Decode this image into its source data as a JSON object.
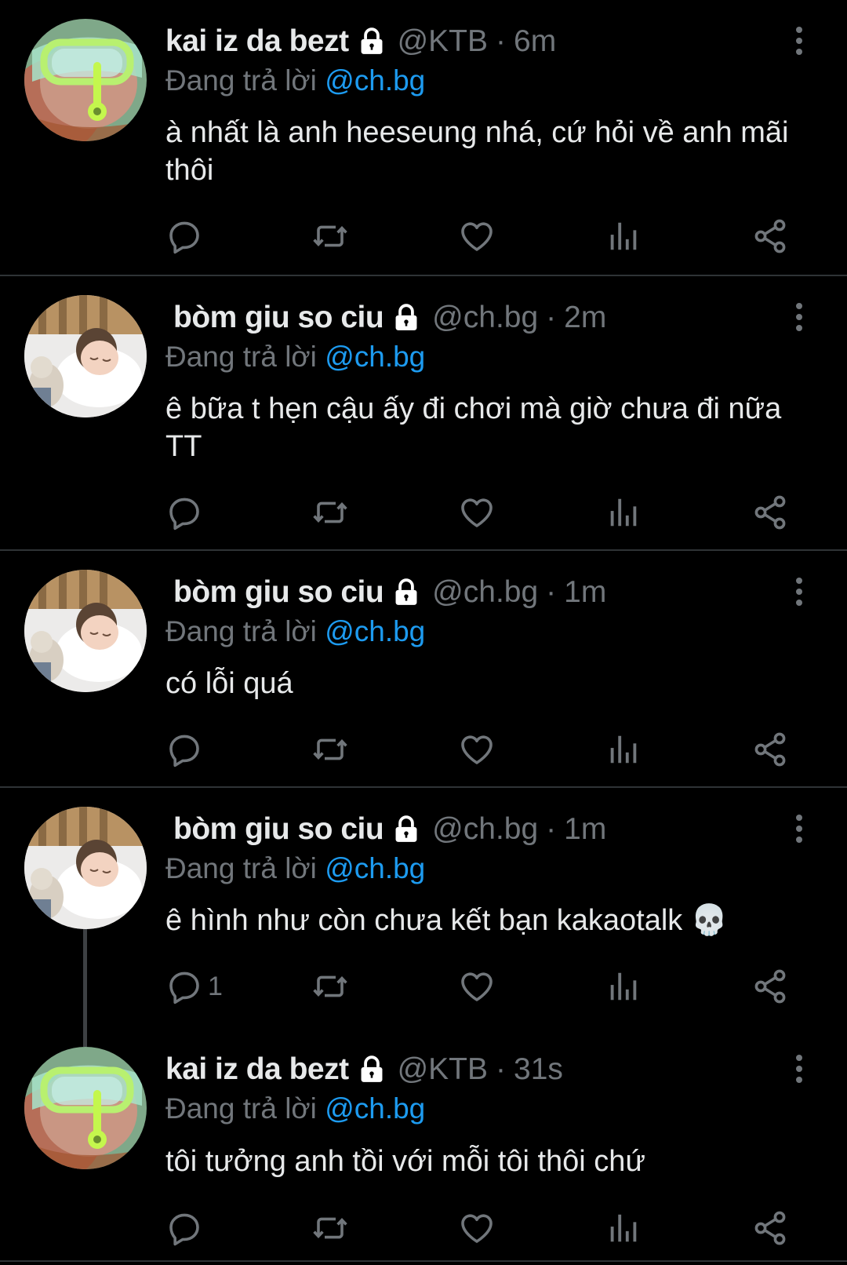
{
  "colors": {
    "background": "#000000",
    "text": "#e7e9ea",
    "secondary": "#71767b",
    "accent": "#1d9bf0",
    "divider": "#2f3336"
  },
  "tweets": [
    {
      "name": "kai iz da bezt",
      "handle": "@KTB",
      "dot": "·",
      "time": "6m",
      "reply_prefix": "Đang trả lời",
      "reply_mention": "@ch.bg",
      "text": "à nhất là anh heeseung nhá, cứ hỏi về anh mãi thôi",
      "reply_count": "",
      "avatar": "snorkel-avatar"
    },
    {
      "name": "bòm giu so ciu",
      "handle": "@ch.bg",
      "dot": "·",
      "time": "2m",
      "reply_prefix": "Đang trả lời",
      "reply_mention": "@ch.bg",
      "text": "ê bữa t hẹn cậu ấy đi chơi mà giờ chưa đi nữa TT",
      "reply_count": "",
      "avatar": "sleeping-child-avatar"
    },
    {
      "name": "bòm giu so ciu",
      "handle": "@ch.bg",
      "dot": "·",
      "time": "1m",
      "reply_prefix": "Đang trả lời",
      "reply_mention": "@ch.bg",
      "text": "có lỗi quá",
      "reply_count": "",
      "avatar": "sleeping-child-avatar"
    },
    {
      "name": "bòm giu so ciu",
      "handle": "@ch.bg",
      "dot": "·",
      "time": "1m",
      "reply_prefix": "Đang trả lời",
      "reply_mention": "@ch.bg",
      "text": "ê hình như còn chưa kết bạn kakaotalk 💀",
      "reply_count": "1",
      "avatar": "sleeping-child-avatar"
    },
    {
      "name": "kai iz da bezt",
      "handle": "@KTB",
      "dot": "·",
      "time": "31s",
      "reply_prefix": "Đang trả lời",
      "reply_mention": "@ch.bg",
      "text": "tôi tưởng anh tồi với mỗi tôi thôi chứ",
      "reply_count": "",
      "avatar": "snorkel-avatar"
    }
  ],
  "icons": {
    "lock": "lock-icon",
    "more": "more-vertical-icon",
    "reply": "reply-icon",
    "retweet": "retweet-icon",
    "like": "heart-icon",
    "views": "analytics-icon",
    "share": "share-icon"
  }
}
